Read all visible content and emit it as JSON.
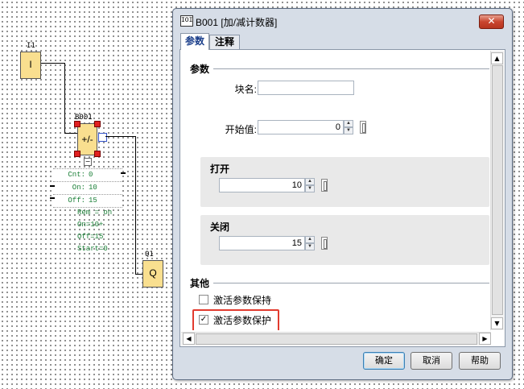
{
  "diagram": {
    "input_block": {
      "name": "I1",
      "symbol": "I"
    },
    "counter_block": {
      "name": "B001",
      "symbol": "+/-",
      "minus_marker": "−"
    },
    "param_table": [
      {
        "key": "Cnt:",
        "value": "0"
      },
      {
        "key": "On:",
        "value": "10"
      },
      {
        "key": "Off:",
        "value": "15"
      }
    ],
    "remarks": [
      "Rem = on",
      "On=10+",
      "Off=15",
      "Start=0"
    ],
    "output_block": {
      "name": "Q1",
      "symbol": "Q"
    }
  },
  "dialog": {
    "icon_text": "IOI",
    "title": "B001 [加/减计数器]",
    "close_label": "✕",
    "tabs": [
      {
        "label": "参数",
        "active": true
      },
      {
        "label": "注释",
        "active": false
      }
    ],
    "params_section": "参数",
    "block_name_label": "块名:",
    "block_name_value": "",
    "start_value_label": "开始值:",
    "start_value": "0",
    "on_group": {
      "title": "打开",
      "value": "10"
    },
    "off_group": {
      "title": "关闭",
      "value": "15"
    },
    "other_section": "其他",
    "retentive": {
      "label": "激活参数保持",
      "checked": false
    },
    "protection": {
      "label": "激活参数保护",
      "checked": true
    },
    "buttons": {
      "ok": "确定",
      "cancel": "取消",
      "help": "帮助"
    },
    "spin_up": "▲",
    "spin_down": "▼",
    "scroll_up": "▲",
    "scroll_down": "▼",
    "scroll_left": "◀",
    "scroll_right": "▶",
    "check_mark": "✓",
    "accent_colors": {
      "title_text": "#1b3f8b",
      "highlight": "#e23b2f",
      "close": "#c9452f",
      "block": "#f9df8f"
    }
  }
}
